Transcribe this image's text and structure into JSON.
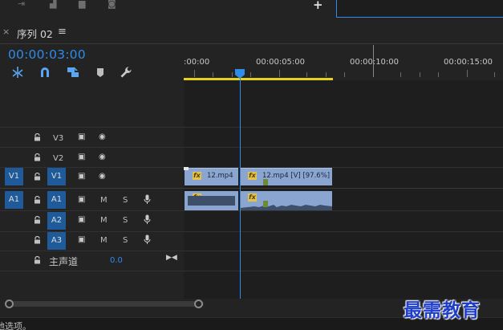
{
  "window": {
    "panel_title": "序列 02",
    "close_glyph": "×",
    "menu_glyph": "≡"
  },
  "toolbar_top": {
    "add_glyph": "+"
  },
  "timeline": {
    "timecode": "00:00:03:00",
    "ruler_labels": [
      ":00:00",
      "00:00:05:00",
      "00:00:10:00",
      "00:00:15:00"
    ],
    "work_area_color": "#e6d21a",
    "accent_color": "#2d8ceb"
  },
  "tools": [
    "snap-icon",
    "magnet-icon",
    "linked-selection-icon",
    "marker-icon",
    "wrench-icon"
  ],
  "video_tracks": [
    {
      "label": "V3",
      "target": "",
      "source": ""
    },
    {
      "label": "V2",
      "target": "",
      "source": ""
    },
    {
      "label": "V1",
      "target": "V1",
      "source": "V1"
    }
  ],
  "audio_tracks": [
    {
      "label": "A1",
      "source": "A1",
      "mute": "M",
      "solo": "S"
    },
    {
      "label": "A2",
      "source": "",
      "mute": "M",
      "solo": "S"
    },
    {
      "label": "A3",
      "source": "",
      "mute": "M",
      "solo": "S"
    }
  ],
  "master_track": {
    "label": "主声道",
    "value": "0.0"
  },
  "clips": {
    "video_1_name": "12.mp4",
    "video_2_name": "12.mp4 [V] [97.6%]",
    "fx_label": "fx"
  },
  "status": {
    "text": "他选项。"
  },
  "watermark": "最需教育"
}
